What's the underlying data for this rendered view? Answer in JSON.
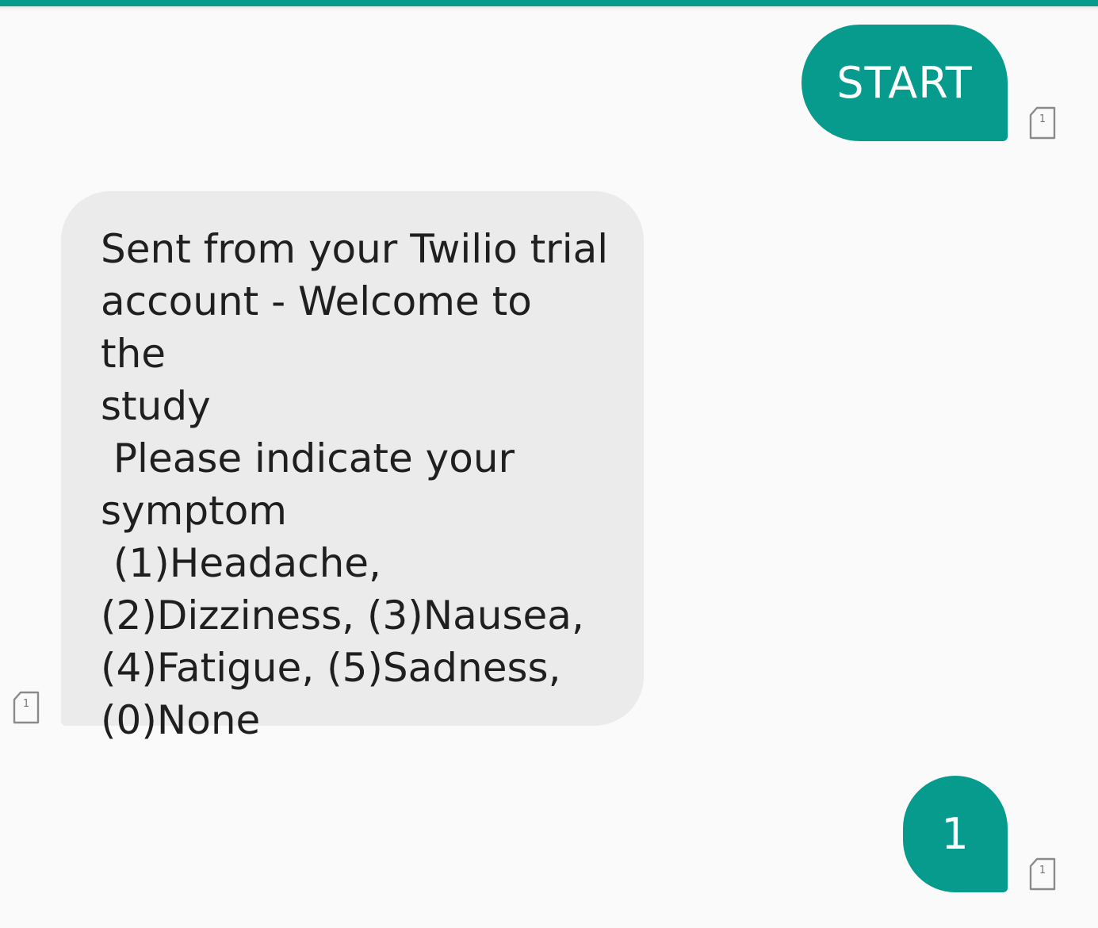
{
  "conversation": {
    "messages": [
      {
        "direction": "outgoing",
        "text": "START",
        "sim_slot": "1"
      },
      {
        "direction": "incoming",
        "text": "Sent from your Twilio trial\naccount - Welcome to the\nstudy\n Please indicate your\nsymptom\n (1)Headache,\n(2)Dizziness, (3)Nausea,\n(4)Fatigue, (5)Sadness,\n(0)None",
        "sim_slot": "1"
      },
      {
        "direction": "outgoing",
        "text": "1",
        "sim_slot": "1"
      }
    ]
  },
  "icons": {
    "sim": "sim-card-icon"
  },
  "colors": {
    "accent": "#069b8c",
    "incoming_bubble": "#ebebeb",
    "background": "#fafafa"
  }
}
